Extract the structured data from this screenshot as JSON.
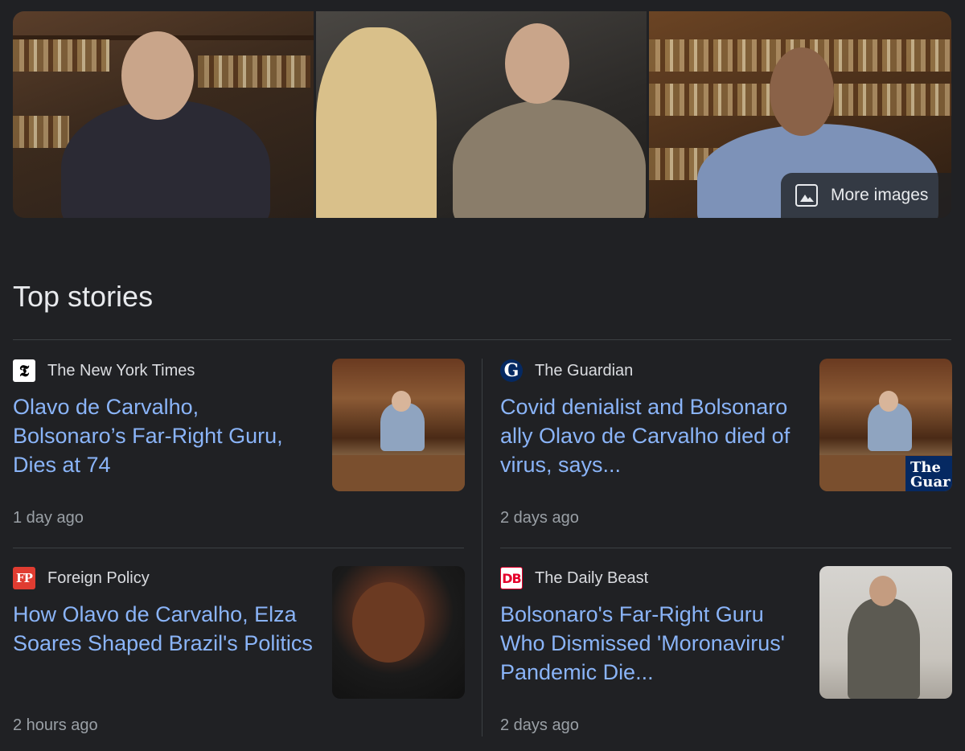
{
  "images": {
    "more_images_label": "More images"
  },
  "top_stories": {
    "title": "Top stories",
    "stories": [
      {
        "source": "The New York Times",
        "logo_text": "𝕿",
        "headline": "Olavo de Carvalho, Bolsonaro’s Far-Right Guru, Dies at 74",
        "time": "1 day ago"
      },
      {
        "source": "The Guardian",
        "logo_text": "G",
        "headline": "Covid denialist and Bolsonaro ally Olavo de Carvalho died of virus, says...",
        "time": "2 days ago",
        "thumb_badge": "The Guar"
      },
      {
        "source": "Foreign Policy",
        "logo_text": "FP",
        "headline": "How Olavo de Carvalho, Elza Soares Shaped Brazil's Politics",
        "time": "2 hours ago"
      },
      {
        "source": "The Daily Beast",
        "logo_text": "DB",
        "headline": "Bolsonaro's Far-Right Guru Who Dismissed 'Moronavirus' Pandemic Die...",
        "time": "2 days ago"
      }
    ]
  },
  "colors": {
    "background": "#202124",
    "link": "#8ab4f8",
    "muted": "#9aa0a6",
    "divider": "#3c4043"
  }
}
